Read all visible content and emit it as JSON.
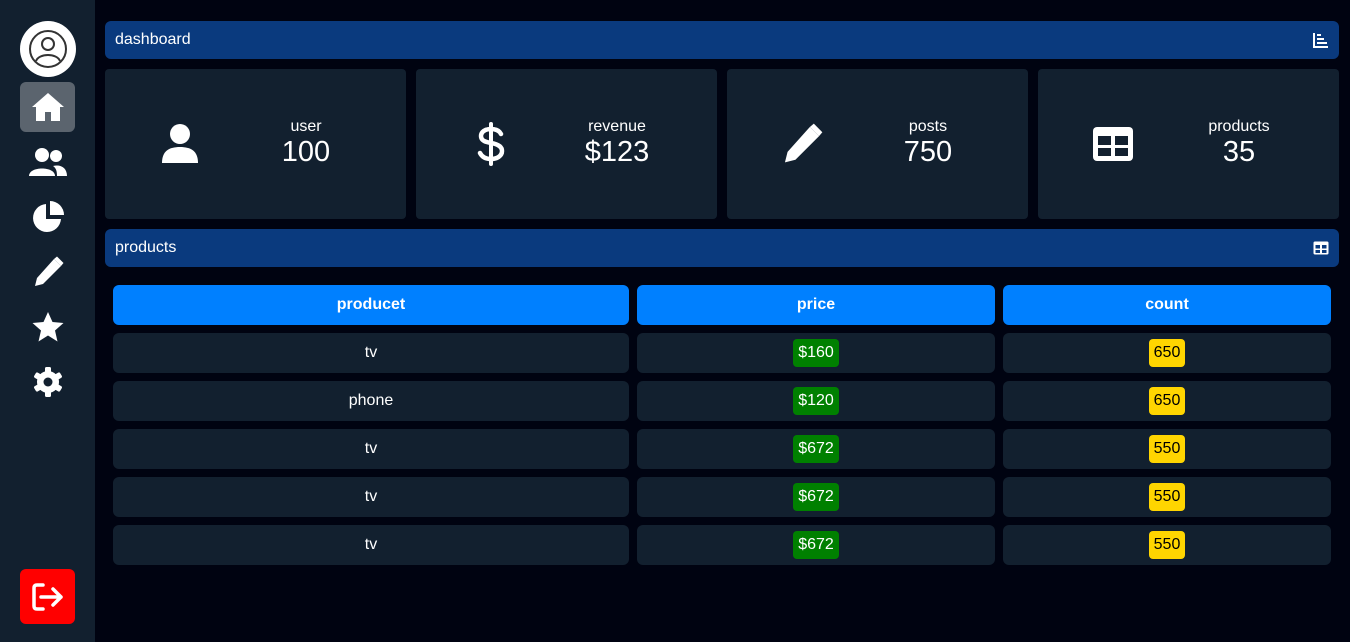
{
  "sidebar": {
    "items": [
      {
        "icon": "home-icon",
        "active": true
      },
      {
        "icon": "users-icon",
        "active": false
      },
      {
        "icon": "chart-pie-icon",
        "active": false
      },
      {
        "icon": "pencil-icon",
        "active": false
      },
      {
        "icon": "star-icon",
        "active": false
      },
      {
        "icon": "gear-icon",
        "active": false
      }
    ],
    "logout_icon": "logout-icon"
  },
  "dashboard": {
    "title": "dashboard",
    "icon": "chart-icon",
    "stats": [
      {
        "label": "user",
        "value": "100",
        "icon": "user-icon"
      },
      {
        "label": "revenue",
        "value": "$123",
        "icon": "dollar-icon"
      },
      {
        "label": "posts",
        "value": "750",
        "icon": "pencil-icon"
      },
      {
        "label": "products",
        "value": "35",
        "icon": "table-icon"
      }
    ]
  },
  "products": {
    "title": "products",
    "icon": "table-icon",
    "headers": [
      "producet",
      "price",
      "count"
    ],
    "rows": [
      {
        "product": "tv",
        "price": "$160",
        "count": "650"
      },
      {
        "product": "phone",
        "price": "$120",
        "count": "650"
      },
      {
        "product": "tv",
        "price": "$672",
        "count": "550"
      },
      {
        "product": "tv",
        "price": "$672",
        "count": "550"
      },
      {
        "product": "tv",
        "price": "$672",
        "count": "550"
      }
    ]
  },
  "colors": {
    "background": "#000311",
    "panel": "#12202f",
    "bar": "#0a3a7e",
    "header_cell": "#0080ff",
    "price_badge": "#008000",
    "count_badge": "#ffd500",
    "logout": "#ff0000"
  }
}
